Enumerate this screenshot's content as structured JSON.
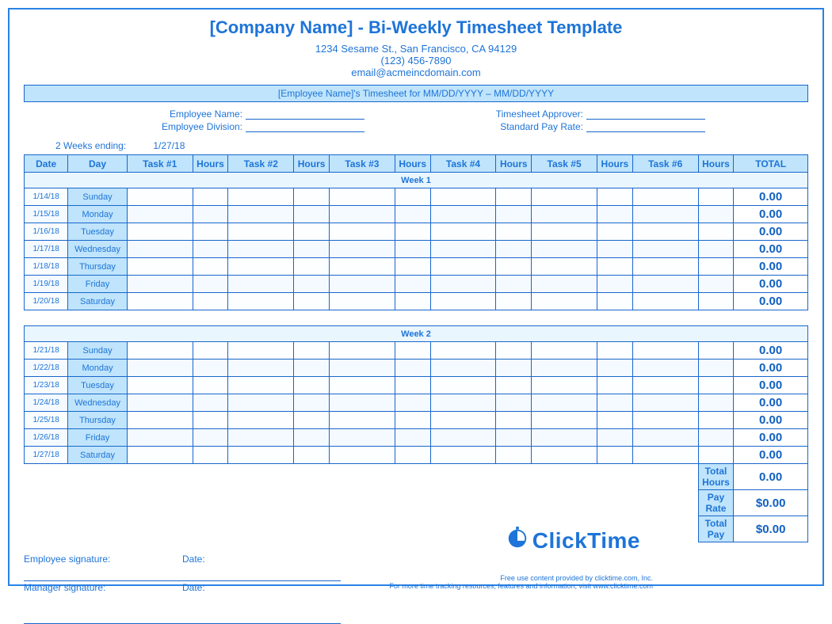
{
  "header": {
    "title": "[Company Name] - Bi-Weekly Timesheet Template",
    "address": "1234 Sesame St.,  San Francisco, CA 94129",
    "phone": "(123) 456-7890",
    "email": "email@acmeincdomain.com",
    "subtitle": "[Employee Name]'s Timesheet for MM/DD/YYYY – MM/DD/YYYY"
  },
  "meta": {
    "emp_name_label": "Employee Name:",
    "emp_div_label": "Employee Division:",
    "approver_label": "Timesheet Approver:",
    "payrate_label": "Standard Pay Rate:",
    "weeks_ending_label": "2 Weeks ending:",
    "weeks_ending_value": "1/27/18"
  },
  "columns": {
    "date": "Date",
    "day": "Day",
    "t1": "Task #1",
    "h1": "Hours",
    "t2": "Task #2",
    "h2": "Hours",
    "t3": "Task #3",
    "h3": "Hours",
    "t4": "Task #4",
    "h4": "Hours",
    "t5": "Task #5",
    "h5": "Hours",
    "t6": "Task #6",
    "h6": "Hours",
    "total": "TOTAL"
  },
  "week1_label": "Week 1",
  "week2_label": "Week 2",
  "rows_week1": [
    {
      "date": "1/14/18",
      "day": "Sunday",
      "total": "0.00"
    },
    {
      "date": "1/15/18",
      "day": "Monday",
      "total": "0.00"
    },
    {
      "date": "1/16/18",
      "day": "Tuesday",
      "total": "0.00"
    },
    {
      "date": "1/17/18",
      "day": "Wednesday",
      "total": "0.00"
    },
    {
      "date": "1/18/18",
      "day": "Thursday",
      "total": "0.00"
    },
    {
      "date": "1/19/18",
      "day": "Friday",
      "total": "0.00"
    },
    {
      "date": "1/20/18",
      "day": "Saturday",
      "total": "0.00"
    }
  ],
  "rows_week2": [
    {
      "date": "1/21/18",
      "day": "Sunday",
      "total": "0.00"
    },
    {
      "date": "1/22/18",
      "day": "Monday",
      "total": "0.00"
    },
    {
      "date": "1/23/18",
      "day": "Tuesday",
      "total": "0.00"
    },
    {
      "date": "1/24/18",
      "day": "Wednesday",
      "total": "0.00"
    },
    {
      "date": "1/25/18",
      "day": "Thursday",
      "total": "0.00"
    },
    {
      "date": "1/26/18",
      "day": "Friday",
      "total": "0.00"
    },
    {
      "date": "1/27/18",
      "day": "Saturday",
      "total": "0.00"
    }
  ],
  "summary": {
    "total_hours_label": "Total Hours",
    "total_hours_value": "0.00",
    "pay_rate_label": "Pay Rate",
    "pay_rate_value": "$0.00",
    "total_pay_label": "Total Pay",
    "total_pay_value": "$0.00"
  },
  "signatures": {
    "emp_sig_label": "Employee signature:",
    "mgr_sig_label": "Manager signature:",
    "date_label": "Date:"
  },
  "footer": {
    "line1": "Free use content provided by clicktime.com, Inc.",
    "line2": "For more time tracking resources, features and information, visit www.clicktime.com",
    "logo_text": "ClickTime"
  }
}
